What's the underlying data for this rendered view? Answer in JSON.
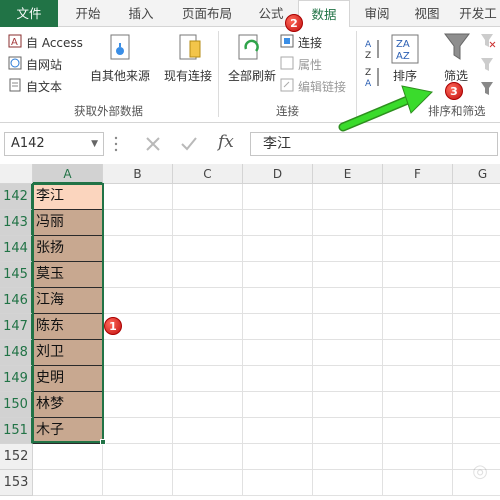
{
  "ribbon_tabs": [
    "文件",
    "开始",
    "插入",
    "页面布局",
    "公式",
    "数据",
    "审阅",
    "视图",
    "开发工"
  ],
  "ribbon": {
    "get_external": {
      "access": "自 Access",
      "web": "自网站",
      "text": "自文本",
      "other_sources": "自其他来源",
      "existing": "现有连接",
      "label": "获取外部数据"
    },
    "connections": {
      "refresh_all": "全部刷新",
      "connections": "连接",
      "properties": "属性",
      "edit_links": "编辑链接",
      "label": "连接"
    },
    "sort_filter": {
      "sort": "排序",
      "filter": "筛选",
      "label": "排序和筛选"
    }
  },
  "formula_bar": {
    "name_box": "A142",
    "fx": "fx",
    "content": "李江"
  },
  "columns": [
    "A",
    "B",
    "C",
    "D",
    "E",
    "F",
    "G"
  ],
  "rows": [
    {
      "num": "142",
      "name": "李江"
    },
    {
      "num": "143",
      "name": "冯丽"
    },
    {
      "num": "144",
      "name": "张扬"
    },
    {
      "num": "145",
      "name": "莫玉"
    },
    {
      "num": "146",
      "name": "江海"
    },
    {
      "num": "147",
      "name": "陈东"
    },
    {
      "num": "148",
      "name": "刘卫"
    },
    {
      "num": "149",
      "name": "史明"
    },
    {
      "num": "150",
      "name": "林梦"
    },
    {
      "num": "151",
      "name": "木子"
    },
    {
      "num": "152",
      "name": ""
    },
    {
      "num": "153",
      "name": ""
    }
  ],
  "annotations": {
    "step1": "1",
    "step2": "2",
    "step3": "3"
  },
  "colors": {
    "accent": "#217346",
    "selection_fill": "#c8a890",
    "active_cell": "#fbd5be",
    "arrow": "#3adb2c",
    "badge": "#d61e1e"
  }
}
